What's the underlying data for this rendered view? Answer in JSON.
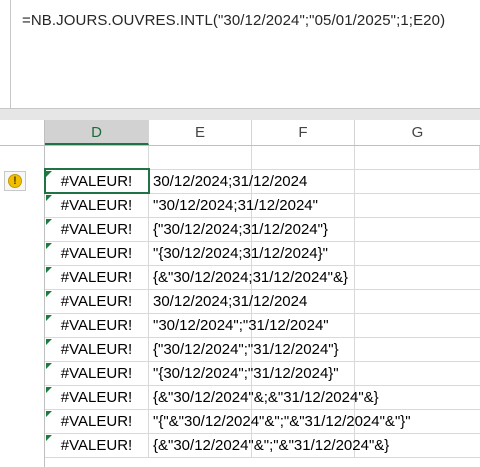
{
  "formula_bar": {
    "text": "=NB.JOURS.OUVRES.INTL(\"30/12/2024\";\"05/01/2025\";1;E20)"
  },
  "columns": [
    "D",
    "E",
    "F",
    "G"
  ],
  "warning_icon": "warning-exclamation-icon",
  "rows": [
    {
      "d": "#VALEUR!",
      "e": "30/12/2024;31/12/2024"
    },
    {
      "d": "#VALEUR!",
      "e": "\"30/12/2024;31/12/2024\""
    },
    {
      "d": "#VALEUR!",
      "e": "{\"30/12/2024;31/12/2024\"}"
    },
    {
      "d": "#VALEUR!",
      "e": "\"{30/12/2024;31/12/2024}\""
    },
    {
      "d": "#VALEUR!",
      "e": "{&\"30/12/2024;31/12/2024\"&}"
    },
    {
      "d": "#VALEUR!",
      "e": "30/12/2024;31/12/2024"
    },
    {
      "d": "#VALEUR!",
      "e": "\"30/12/2024\";\"31/12/2024\""
    },
    {
      "d": "#VALEUR!",
      "e": "{\"30/12/2024\";\"31/12/2024\"}"
    },
    {
      "d": "#VALEUR!",
      "e": "\"{30/12/2024\";\"31/12/2024}\""
    },
    {
      "d": "#VALEUR!",
      "e": "{&\"30/12/2024\"&;&\"31/12/2024\"&}"
    },
    {
      "d": "#VALEUR!",
      "e": "\"{\"&\"30/12/2024\"&\";\"&\"31/12/2024\"&\"}\""
    },
    {
      "d": "#VALEUR!",
      "e": "{&\"30/12/2024\"&\";\"&\"31/12/2024\"&}"
    }
  ],
  "colors": {
    "accent": "#217346",
    "error_indicator": "#1e7b3e",
    "warning": "#f0c000"
  }
}
